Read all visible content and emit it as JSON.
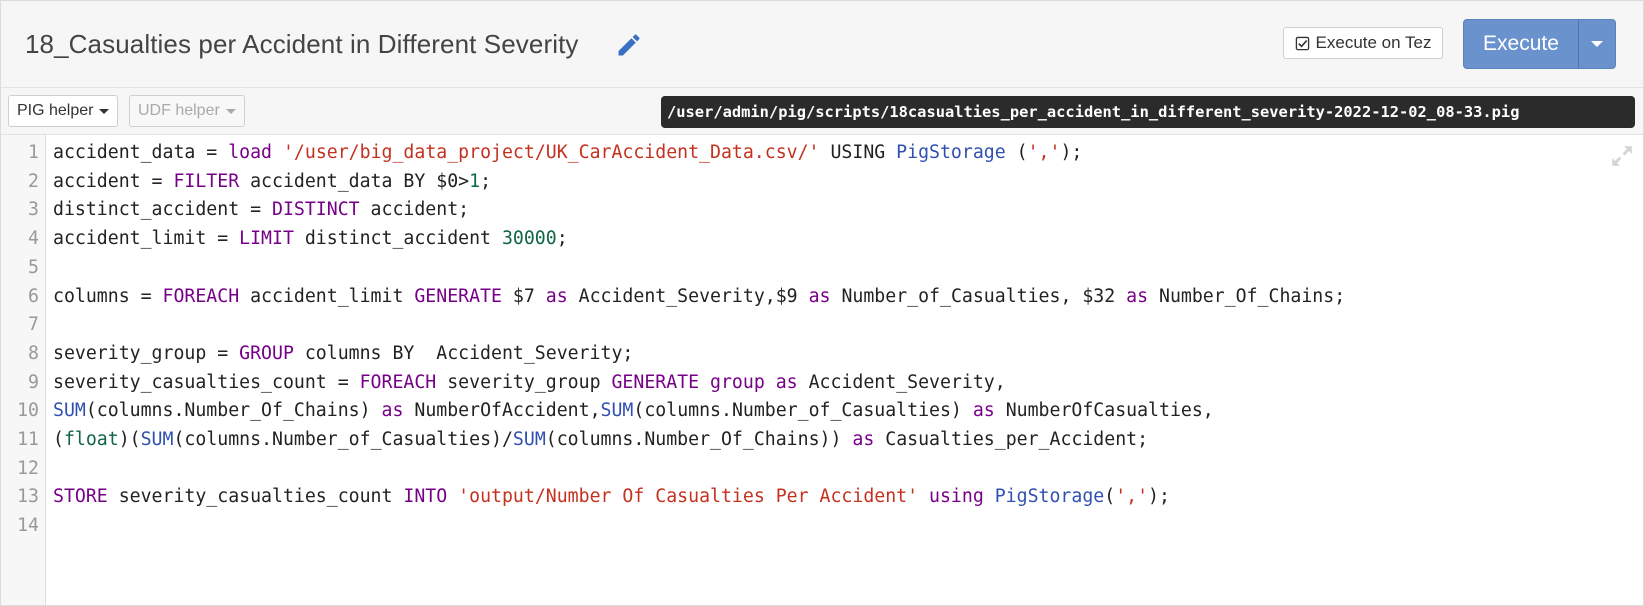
{
  "header": {
    "title": "18_Casualties per Accident in Different Severity",
    "execute_on_tez_label": "Execute on Tez",
    "execute_label": "Execute"
  },
  "toolbar": {
    "pig_helper_label": "PIG helper",
    "udf_helper_label": "UDF helper",
    "script_path": "/user/admin/pig/scripts/18casualties_per_accident_in_different_severity-2022-12-02_08-33.pig"
  },
  "icons": {
    "edit": "pencil-icon",
    "tez_checkbox": "checkbox-checked-icon",
    "dropdown": "chevron-down-icon",
    "fullscreen": "expand-icon"
  },
  "colors": {
    "execute_button": "#6a93ce",
    "keyword": "#770088",
    "string": "#c4321f",
    "number": "#116644",
    "builtin": "#3050b0",
    "pencil": "#3a6fc4"
  },
  "editor": {
    "lines": [
      {
        "n": "1",
        "tokens": [
          [
            "t",
            "accident_data = "
          ],
          [
            "kw",
            "load"
          ],
          [
            "t",
            " "
          ],
          [
            "str",
            "'/user/big_data_project/UK_CarAccident_Data.csv/'"
          ],
          [
            "t",
            " USING "
          ],
          [
            "fn",
            "PigStorage"
          ],
          [
            "t",
            " ("
          ],
          [
            "str",
            "','"
          ],
          [
            "t",
            ");"
          ]
        ]
      },
      {
        "n": "2",
        "tokens": [
          [
            "t",
            "accident = "
          ],
          [
            "kw",
            "FILTER"
          ],
          [
            "t",
            " accident_data BY $0>"
          ],
          [
            "num",
            "1"
          ],
          [
            "t",
            ";"
          ]
        ]
      },
      {
        "n": "3",
        "tokens": [
          [
            "t",
            "distinct_accident = "
          ],
          [
            "kw",
            "DISTINCT"
          ],
          [
            "t",
            " accident;"
          ]
        ]
      },
      {
        "n": "4",
        "tokens": [
          [
            "t",
            "accident_limit = "
          ],
          [
            "kw",
            "LIMIT"
          ],
          [
            "t",
            " distinct_accident "
          ],
          [
            "num",
            "30000"
          ],
          [
            "t",
            ";"
          ]
        ]
      },
      {
        "n": "5",
        "tokens": []
      },
      {
        "n": "6",
        "tokens": [
          [
            "t",
            "columns = "
          ],
          [
            "kw",
            "FOREACH"
          ],
          [
            "t",
            " accident_limit "
          ],
          [
            "kw",
            "GENERATE"
          ],
          [
            "t",
            " $7 "
          ],
          [
            "kw",
            "as"
          ],
          [
            "t",
            " Accident_Severity,$9 "
          ],
          [
            "kw",
            "as"
          ],
          [
            "t",
            " Number_of_Casualties, $32 "
          ],
          [
            "kw",
            "as"
          ],
          [
            "t",
            " Number_Of_Chains;"
          ]
        ]
      },
      {
        "n": "7",
        "tokens": []
      },
      {
        "n": "8",
        "tokens": [
          [
            "t",
            "severity_group = "
          ],
          [
            "kw",
            "GROUP"
          ],
          [
            "t",
            " columns BY  Accident_Severity;"
          ]
        ]
      },
      {
        "n": "9",
        "tokens": [
          [
            "t",
            "severity_casualties_count = "
          ],
          [
            "kw",
            "FOREACH"
          ],
          [
            "t",
            " severity_group "
          ],
          [
            "kw",
            "GENERATE"
          ],
          [
            "t",
            " "
          ],
          [
            "kw",
            "group"
          ],
          [
            "t",
            " "
          ],
          [
            "kw",
            "as"
          ],
          [
            "t",
            " Accident_Severity,"
          ]
        ]
      },
      {
        "n": "10",
        "tokens": [
          [
            "fn",
            "SUM"
          ],
          [
            "t",
            "(columns.Number_Of_Chains) "
          ],
          [
            "kw",
            "as"
          ],
          [
            "t",
            " NumberOfAccident,"
          ],
          [
            "fn",
            "SUM"
          ],
          [
            "t",
            "(columns.Number_of_Casualties) "
          ],
          [
            "kw",
            "as"
          ],
          [
            "t",
            " NumberOfCasualties,"
          ]
        ]
      },
      {
        "n": "11",
        "tokens": [
          [
            "t",
            "("
          ],
          [
            "num",
            "float"
          ],
          [
            "t",
            ")("
          ],
          [
            "fn",
            "SUM"
          ],
          [
            "t",
            "(columns.Number_of_Casualties)/"
          ],
          [
            "fn",
            "SUM"
          ],
          [
            "t",
            "(columns.Number_Of_Chains)) "
          ],
          [
            "kw",
            "as"
          ],
          [
            "t",
            " Casualties_per_Accident;"
          ]
        ]
      },
      {
        "n": "12",
        "tokens": []
      },
      {
        "n": "13",
        "tokens": [
          [
            "kw",
            "STORE"
          ],
          [
            "t",
            " severity_casualties_count "
          ],
          [
            "kw",
            "INTO"
          ],
          [
            "t",
            " "
          ],
          [
            "str",
            "'output/Number Of Casualties Per Accident'"
          ],
          [
            "t",
            " "
          ],
          [
            "kw",
            "using"
          ],
          [
            "t",
            " "
          ],
          [
            "fn",
            "PigStorage"
          ],
          [
            "t",
            "("
          ],
          [
            "str",
            "','"
          ],
          [
            "t",
            ");"
          ]
        ]
      },
      {
        "n": "14",
        "tokens": []
      }
    ]
  }
}
